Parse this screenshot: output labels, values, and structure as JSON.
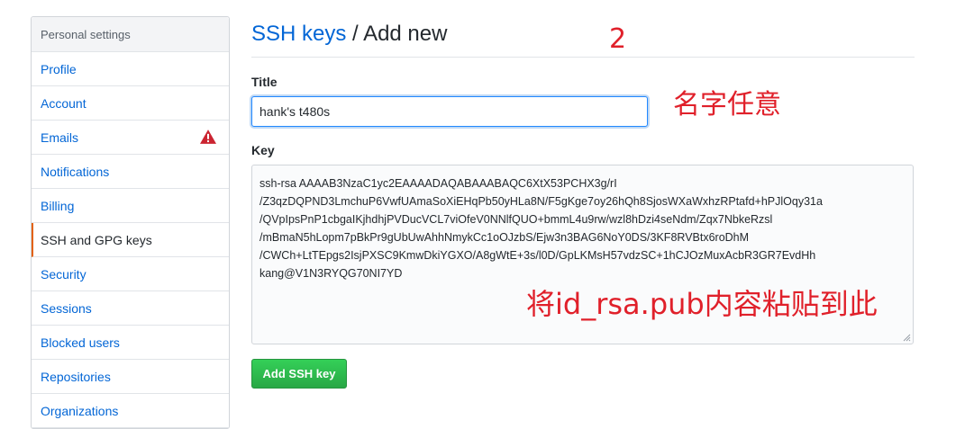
{
  "sidebar": {
    "header": "Personal settings",
    "items": [
      {
        "label": "Profile"
      },
      {
        "label": "Account"
      },
      {
        "label": "Emails"
      },
      {
        "label": "Notifications"
      },
      {
        "label": "Billing"
      },
      {
        "label": "SSH and GPG keys"
      },
      {
        "label": "Security"
      },
      {
        "label": "Sessions"
      },
      {
        "label": "Blocked users"
      },
      {
        "label": "Repositories"
      },
      {
        "label": "Organizations"
      }
    ],
    "selected": "SSH and GPG keys",
    "emails_warning_icon": "alert-icon"
  },
  "header": {
    "breadcrumb": "SSH keys",
    "separator": "/",
    "title": "Add new"
  },
  "form": {
    "title_label": "Title",
    "title_value": "hank's t480s",
    "key_label": "Key",
    "key_value": "ssh-rsa AAAAB3NzaC1yc2EAAAADAQABAAABAQC6XtX53PCHX3g/rI\n/Z3qzDQPND3LmchuP6VwfUAmaSoXiEHqPb50yHLa8N/F5gKge7oy26hQh8SjosWXaWxhzRPtafd+hPJlOqy31a\n/QVpIpsPnP1cbgaIKjhdhjPVDucVCL7viOfeV0NNlfQUO+bmmL4u9rw/wzl8hDzi4seNdm/Zqx7NbkeRzsl\n/mBmaN5hLopm7pBkPr9gUbUwAhhNmykCc1oOJzbS/Ejw3n3BAG6NoY0DS/3KF8RVBtx6roDhM\n/CWCh+LtTEpgs2IsjPXSC9KmwDkiYGXO/A8gWtE+3s/l0D/GpLKMsH57vdzSC+1hCJOzMuxAcbR3GR7EvdHh\nkang@V1N3RYQG70NI7YD",
    "submit_label": "Add SSH key"
  },
  "annotations": {
    "step": "2",
    "title_note": "名字任意",
    "key_note": "将id_rsa.pub内容粘贴到此"
  },
  "colors": {
    "link": "#0366d6",
    "selected_border": "#e36209",
    "button_green": "#28a745",
    "annotation_red": "#e0202a",
    "warning": "#cb2431"
  }
}
